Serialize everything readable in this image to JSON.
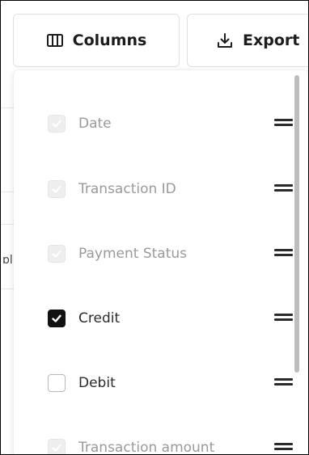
{
  "toolbar": {
    "columns_label": "Columns",
    "export_label": "Export"
  },
  "column_menu": {
    "items": [
      {
        "label": "Date",
        "state": "checked-disabled"
      },
      {
        "label": "Transaction ID",
        "state": "checked-disabled"
      },
      {
        "label": "Payment Status",
        "state": "checked-disabled"
      },
      {
        "label": "Credit",
        "state": "checked"
      },
      {
        "label": "Debit",
        "state": "unchecked"
      },
      {
        "label": "Transaction amount",
        "state": "checked-disabled"
      }
    ]
  },
  "icons": {
    "columns": "columns-icon",
    "export": "download-icon",
    "drag": "drag-handle-icon",
    "check": "checkmark-icon"
  },
  "colors": {
    "checked": "#111111",
    "disabled_check": "#eeeeee",
    "muted_text": "#9a9a9a",
    "scrollbar": "#bdbdbd"
  }
}
